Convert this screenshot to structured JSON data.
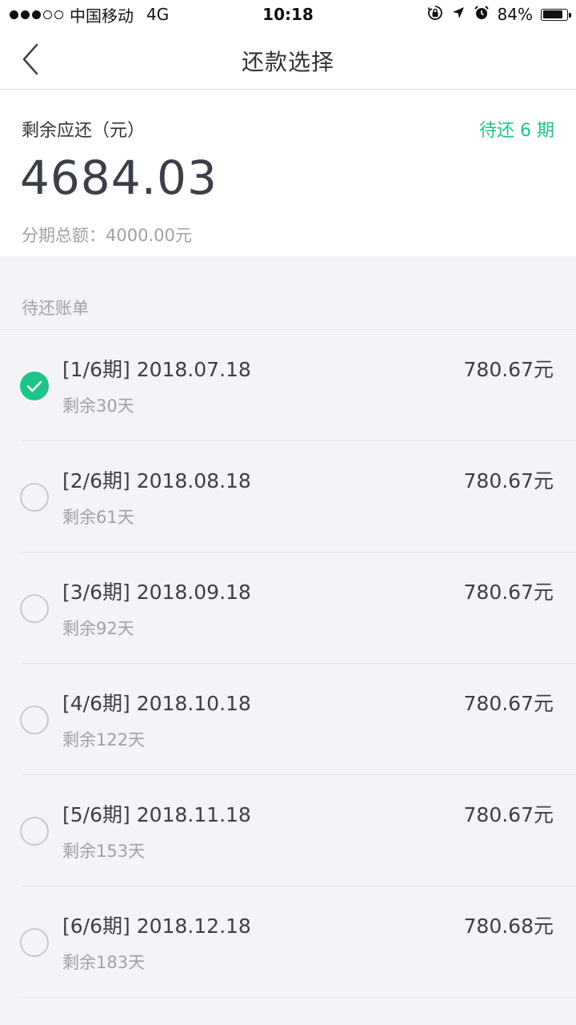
{
  "status_bar": {
    "carrier": "中国移动",
    "network": "4G",
    "time": "10:18",
    "battery": "84%",
    "battery_level": 0.84,
    "icons": [
      "orientation-lock-icon",
      "location-arrow-icon",
      "alarm-icon",
      "battery-icon"
    ]
  },
  "nav": {
    "title": "还款选择",
    "back_icon": "chevron-left-icon"
  },
  "summary": {
    "label": "剩余应还（元）",
    "pending": "待还 6 期",
    "amount": "4684.03",
    "total": "分期总额：4000.00元"
  },
  "section": {
    "title": "待还账单"
  },
  "bills": [
    {
      "title": "[1/6期] 2018.07.18",
      "amount": "780.67元",
      "remaining": "剩余30天",
      "selected": true
    },
    {
      "title": "[2/6期] 2018.08.18",
      "amount": "780.67元",
      "remaining": "剩余61天",
      "selected": false
    },
    {
      "title": "[3/6期] 2018.09.18",
      "amount": "780.67元",
      "remaining": "剩余92天",
      "selected": false
    },
    {
      "title": "[4/6期] 2018.10.18",
      "amount": "780.67元",
      "remaining": "剩余122天",
      "selected": false
    },
    {
      "title": "[5/6期] 2018.11.18",
      "amount": "780.67元",
      "remaining": "剩余153天",
      "selected": false
    },
    {
      "title": "[6/6期] 2018.12.18",
      "amount": "780.68元",
      "remaining": "剩余183天",
      "selected": false
    }
  ],
  "colors": {
    "accent": "#1ec48a",
    "text_primary": "#3b3f47",
    "text_secondary": "#a0a0a6",
    "background": "#f4f4f8"
  }
}
